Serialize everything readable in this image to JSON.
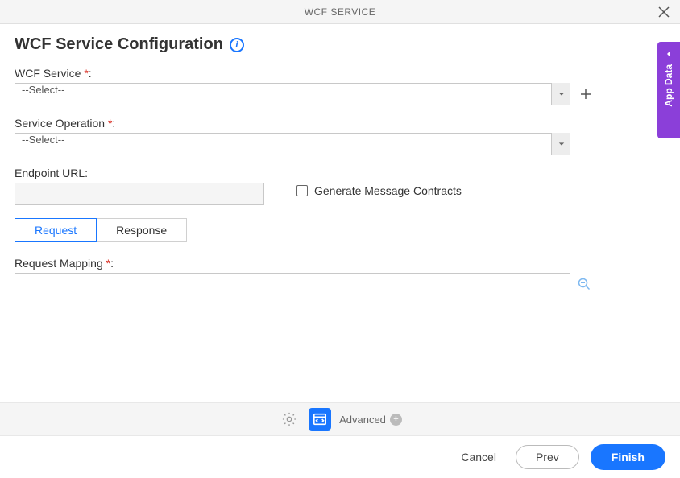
{
  "header": {
    "title": "WCF SERVICE"
  },
  "page": {
    "title": "WCF Service Configuration"
  },
  "form": {
    "wcf_service": {
      "label": "WCF Service",
      "value": "--Select--"
    },
    "service_operation": {
      "label": "Service Operation",
      "value": "--Select--"
    },
    "endpoint_url": {
      "label": "Endpoint URL:"
    },
    "generate_contracts": {
      "label": "Generate Message Contracts"
    },
    "request_mapping": {
      "label": "Request Mapping"
    }
  },
  "tabs": {
    "request": "Request",
    "response": "Response"
  },
  "toolbar": {
    "advanced": "Advanced"
  },
  "footer": {
    "cancel": "Cancel",
    "prev": "Prev",
    "finish": "Finish"
  },
  "side": {
    "label": "App Data"
  }
}
